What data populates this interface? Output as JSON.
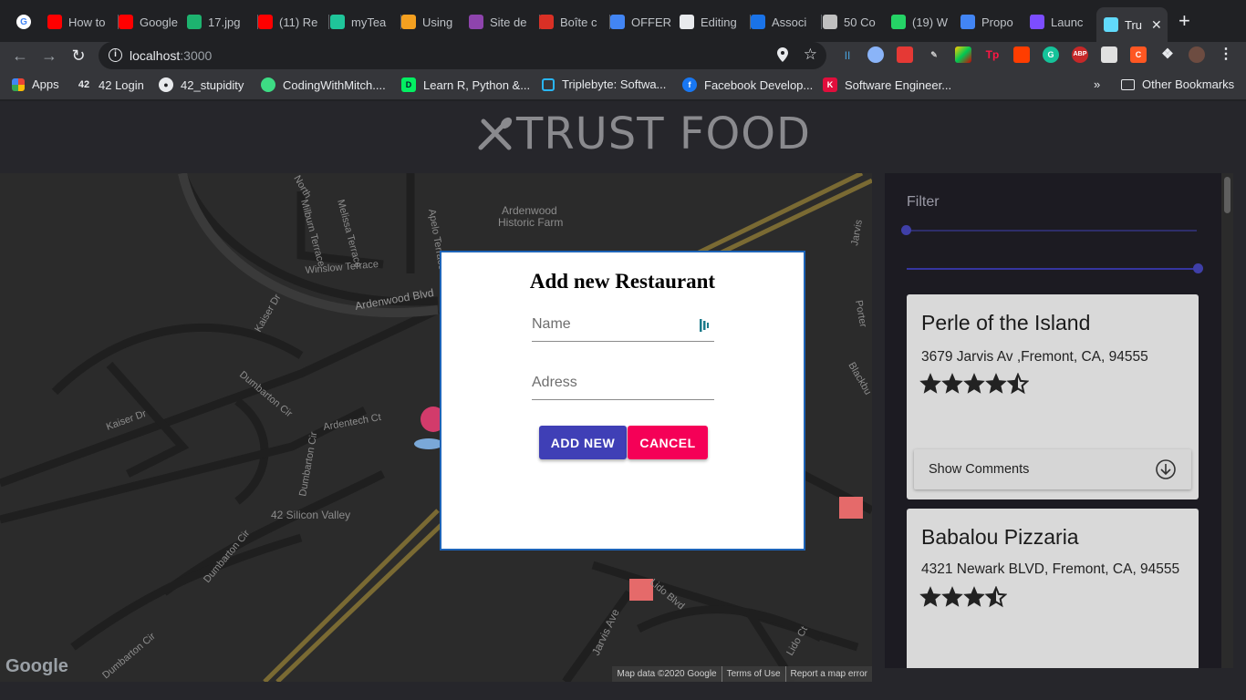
{
  "browser": {
    "tabs": [
      {
        "title": "How to",
        "icon": "youtube-icon",
        "color": "#ff0000"
      },
      {
        "title": "Google",
        "icon": "youtube-icon",
        "color": "#ff0000"
      },
      {
        "title": "17.jpg",
        "icon": "p-icon",
        "color": "#1db36f"
      },
      {
        "title": "(11) Re",
        "icon": "youtube-icon",
        "color": "#ff0000"
      },
      {
        "title": "myTea",
        "icon": "t-icon",
        "color": "#1fc59a"
      },
      {
        "title": "Using",
        "icon": "bookmark-icon",
        "color": "#f4a020"
      },
      {
        "title": "Site de",
        "icon": "m-icon",
        "color": "#8e44ad"
      },
      {
        "title": "Boîte c",
        "icon": "gmail-icon",
        "color": "#d93025"
      },
      {
        "title": "OFFER",
        "icon": "docs-icon",
        "color": "#4285f4"
      },
      {
        "title": "Editing",
        "icon": "github-icon",
        "color": "#e8eaed"
      },
      {
        "title": "Associ",
        "icon": "info-icon",
        "color": "#1a73e8"
      },
      {
        "title": "50 Co",
        "icon": "cup-icon",
        "color": "#c0c0c0"
      },
      {
        "title": "(19) W",
        "icon": "whatsapp-icon",
        "color": "#25d366"
      },
      {
        "title": "Propo",
        "icon": "docs-icon",
        "color": "#4285f4"
      },
      {
        "title": "Launc",
        "icon": "d-icon",
        "color": "#7c4dff"
      },
      {
        "title": "Tru",
        "icon": "react-icon",
        "color": "#61dafb"
      }
    ],
    "url_host": "localhost",
    "url_port": ":3000",
    "bookmarks": [
      {
        "label": "Apps"
      },
      {
        "label": "42 Login"
      },
      {
        "label": "42_stupidity"
      },
      {
        "label": "CodingWithMitch...."
      },
      {
        "label": "Learn R, Python &..."
      },
      {
        "label": "Triplebyte: Softwa..."
      },
      {
        "label": "Facebook Develop..."
      },
      {
        "label": "Software Engineer..."
      }
    ],
    "bookmarks_more": "»",
    "other_bookmarks": "Other Bookmarks"
  },
  "header": {
    "logo_text": "TRUST FOOD"
  },
  "map": {
    "labels": [
      "Ardenwood Historic Farm",
      "Ardenwood Blvd",
      "Winslow Terrace",
      "Milburn Terrace",
      "Melissa Terrace",
      "Kaiser Dr",
      "Dumbarton Cir",
      "Ardentech Ct",
      "42 Silicon Valley",
      "Jarvis Ave",
      "Lido Blvd",
      "Lido Ct",
      "Blackbu",
      "Porter",
      "North",
      "Jarvis"
    ],
    "logo": "Google",
    "footer": [
      "Map data ©2020 Google",
      "Terms of Use",
      "Report a map error"
    ]
  },
  "sidebar": {
    "filter_label": "Filter",
    "restaurants": [
      {
        "name": "Perle of the Island",
        "address": "3679 Jarvis Av ,Fremont, CA, 94555",
        "rating": 4.5
      },
      {
        "name": "Babalou Pizzaria",
        "address": "4321 Newark BLVD, Fremont, CA, 94555",
        "rating": 3.5
      }
    ],
    "show_comments_label": "Show Comments"
  },
  "modal": {
    "title": "Add new Restaurant",
    "name_placeholder": "Name",
    "address_placeholder": "Adress",
    "add_label": "ADD NEW",
    "cancel_label": "CANCEL"
  }
}
